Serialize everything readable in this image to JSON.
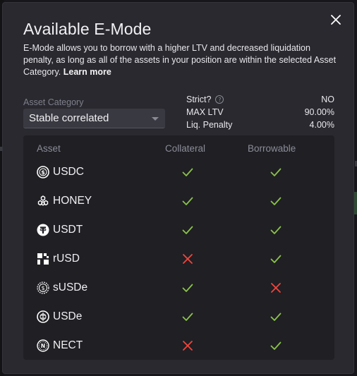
{
  "modal": {
    "title": "Available E-Mode",
    "description": "E-Mode allows you to borrow with a higher LTV and decreased liquidation penalty, as long as all of the assets in your position are within the selected Asset Category.",
    "learn_more": "Learn more",
    "close_icon": "close-icon"
  },
  "category": {
    "label": "Asset Category",
    "selected": "Stable correlated"
  },
  "info": {
    "strict_label": "Strict?",
    "strict_value": "NO",
    "max_ltv_label": "MAX LTV",
    "max_ltv_value": "90.00%",
    "liq_penalty_label": "Liq. Penalty",
    "liq_penalty_value": "4.00%"
  },
  "table": {
    "headers": {
      "asset": "Asset",
      "collateral": "Collateral",
      "borrowable": "Borrowable"
    },
    "rows": [
      {
        "asset": "USDC",
        "icon": "usdc-icon",
        "collateral": true,
        "borrowable": true
      },
      {
        "asset": "HONEY",
        "icon": "honey-icon",
        "collateral": true,
        "borrowable": true
      },
      {
        "asset": "USDT",
        "icon": "usdt-icon",
        "collateral": true,
        "borrowable": true
      },
      {
        "asset": "rUSD",
        "icon": "rusd-icon",
        "collateral": false,
        "borrowable": true
      },
      {
        "asset": "sUSDe",
        "icon": "susde-icon",
        "collateral": true,
        "borrowable": false
      },
      {
        "asset": "USDe",
        "icon": "usde-icon",
        "collateral": true,
        "borrowable": true
      },
      {
        "asset": "NECT",
        "icon": "nect-icon",
        "collateral": false,
        "borrowable": true
      }
    ]
  },
  "colors": {
    "check": "#8bc34a",
    "cross": "#f0463c"
  }
}
